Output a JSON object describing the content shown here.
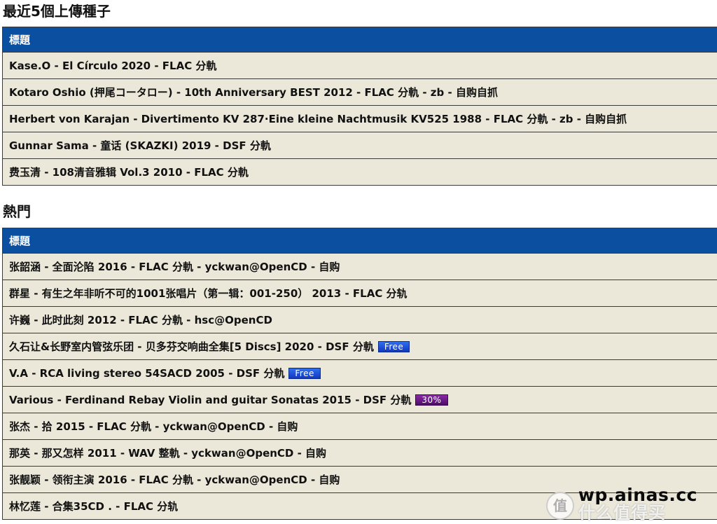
{
  "recent": {
    "title": "最近5個上傳種子",
    "header": "標題",
    "rows": [
      {
        "text": "Kase.O - El Círculo 2020 - FLAC 分軌"
      },
      {
        "text": "Kotaro Oshio (押尾コータロー) - 10th Anniversary BEST 2012 - FLAC 分軌 - zb - 自购自抓"
      },
      {
        "text": "Herbert von Karajan - Divertimento KV 287·Eine kleine Nachtmusik KV525 1988 - FLAC 分軌 - zb - 自购自抓"
      },
      {
        "text": "Gunnar Sama - 童话 (SKAZKI) 2019 - DSF 分軌"
      },
      {
        "text": "费玉清 - 108清音雅辑 Vol.3 2010 - FLAC 分軌"
      }
    ]
  },
  "hot": {
    "title": "熱門",
    "header": "標題",
    "rows": [
      {
        "text": "张韶涵 - 全面沦陷 2016 - FLAC 分軌 - yckwan@OpenCD - 自购"
      },
      {
        "text": "群星 - 有生之年非听不可的1001张唱片（第一辑：001-250） 2013 - FLAC 分轨"
      },
      {
        "text": "许巍 - 此时此刻 2012 - FLAC 分軌 - hsc@OpenCD"
      },
      {
        "text": "久石让&长野室内管弦乐团 - 贝多芬交响曲全集[5 Discs] 2020 - DSF 分軌",
        "badge": "Free"
      },
      {
        "text": "V.A - RCA living stereo 54SACD 2005 - DSF 分軌",
        "badge": "Free"
      },
      {
        "text": "Various - Ferdinand Rebay Violin and guitar Sonatas 2015 - DSF 分軌",
        "badge": "30%"
      },
      {
        "text": "张杰 - 拾 2015 - FLAC 分軌 - yckwan@OpenCD - 自购"
      },
      {
        "text": "那英 - 那又怎样 2011 - WAV 整軌 - yckwan@OpenCD - 自购"
      },
      {
        "text": "张靓颖 - 领衔主演 2016 - FLAC 分軌 - yckwan@OpenCD - 自购"
      },
      {
        "text": "林忆莲 - 合集35CD . - FLAC 分轨"
      }
    ]
  },
  "watermark": {
    "site": "wp.ainas.cc",
    "brand": "什么值得买",
    "logo_char": "值"
  },
  "colors": {
    "header_bg": "#0a4fa0",
    "row_bg": "#ebe8d9",
    "free_badge": "#1f4fd8",
    "pct_badge": "#6a1a8a"
  }
}
